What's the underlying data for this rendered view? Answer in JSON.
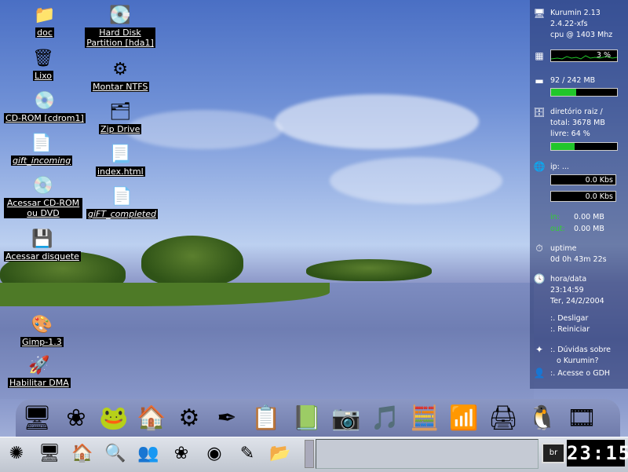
{
  "desktop_icons": [
    {
      "label": "doc",
      "icon": "folder-icon"
    },
    {
      "label": "Hard Disk\nPartition [hda1]",
      "icon": "hard-disk-icon"
    },
    {
      "label": "Lixo",
      "icon": "trash-icon"
    },
    {
      "label": "Montar NTFS",
      "icon": "gear-icon"
    },
    {
      "label": "CD-ROM [cdrom1]",
      "icon": "cdrom-icon"
    },
    {
      "label": "Zip Drive",
      "icon": "zip-drive-icon"
    },
    {
      "label": "gift_incoming",
      "icon": "folder-link-icon"
    },
    {
      "label": "index.html",
      "icon": "html-file-icon"
    },
    {
      "label": "Acessar CD-ROM\nou DVD",
      "icon": "cdrom-icon"
    },
    {
      "label": "giFT_completed",
      "icon": "folder-link-icon"
    },
    {
      "label": "Acessar disquete",
      "icon": "floppy-icon"
    },
    {
      "label": "Gimp-1.3",
      "icon": "gimp-icon"
    },
    {
      "label": "Habilitar DMA",
      "icon": "rocket-icon"
    }
  ],
  "sysmon": {
    "system": "Kurumin 2.13",
    "kernel": "2.4.22-xfs",
    "cpu": "cpu @ 1403 Mhz",
    "cpu_load": "3 %",
    "memory": "92 / 242 MB",
    "memory_fraction": 0.38,
    "disk_title": "diretório raiz /",
    "disk_total": "total: 3678 MB",
    "disk_free": "livre: 64 %",
    "disk_fraction": 0.36,
    "ip_label": "ip: ...",
    "net_down": "0.0 Kbs",
    "net_up": "0.0 Kbs",
    "in_label": "in:",
    "in_value": "0.00 MB",
    "out_label": "out:",
    "out_value": "0.00 MB",
    "uptime_label": "uptime",
    "uptime_value": "0d 0h 43m 22s",
    "datetime_label": "hora/data",
    "time": "23:14:59",
    "date": "Ter, 24/2/2004",
    "shutdown": ":. Desligar",
    "reboot": ":. Reiniciar",
    "help1": ":. Dúvidas sobre",
    "help2": "o Kurumin?",
    "gdh": ":. Acesse o GDH"
  },
  "dock_icons": [
    "computer-icon",
    "icq-flower-icon",
    "chat-mascot-icon",
    "home-icon",
    "control-center-icon",
    "pen-icon",
    "office-icon",
    "editor-icon",
    "camera-icon",
    "music-icon",
    "calculator-icon",
    "network-icon",
    "printer-icon",
    "tux-icon",
    "video-icon"
  ],
  "panel": {
    "launchers": [
      "kmenu-icon",
      "desktop-icon",
      "home-icon",
      "browser-icon",
      "users-icon",
      "icq-icon",
      "media-icon",
      "editor-icon",
      "files-icon"
    ],
    "keyboard_layout": "br",
    "clock": "23:15"
  }
}
